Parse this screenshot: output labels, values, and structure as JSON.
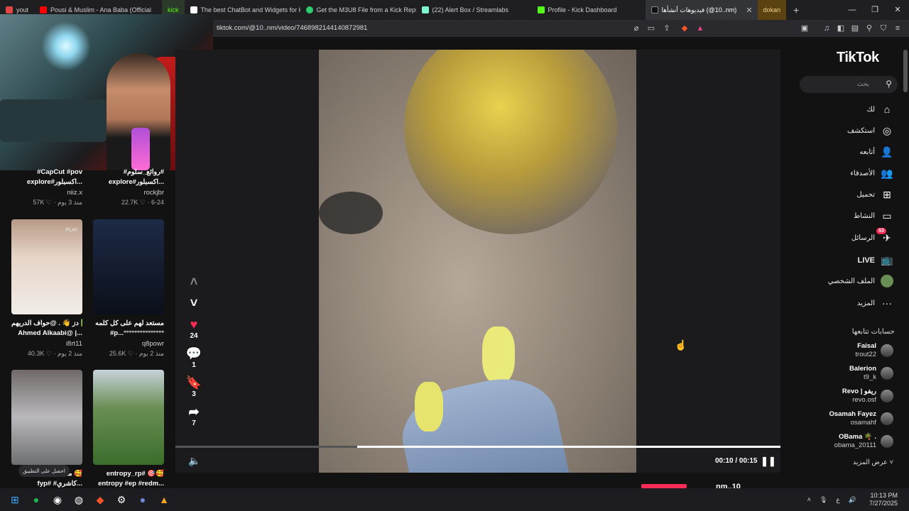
{
  "browser": {
    "tabs": [
      {
        "label": "yout",
        "color": "#e04646"
      },
      {
        "label": "Pousi & Muslim - Ana Baba (Official",
        "color": "#ff0000"
      },
      {
        "label": "kick",
        "color": "#53fc18"
      },
      {
        "label": "The best ChatBot and Widgets for Ki",
        "color": "#ffffff"
      },
      {
        "label": "Get the M3U8 File from a Kick Replay",
        "color": "#2ecc71"
      },
      {
        "label": "(22) Alert Box / Streamlabs",
        "color": "#80f5d2"
      },
      {
        "label": "Profile - Kick Dashboard",
        "color": "#53fc18"
      },
      {
        "label": "فيديوهات أنشأها (@10..nm)",
        "color": "#111111"
      },
      {
        "label": "dokan",
        "color": "#c99a2e"
      }
    ],
    "url": "tiktok.com/@10..nm/video/7468982144140872981"
  },
  "left_grid": {
    "cards": [
      {
        "caption": "#CapCut #pov",
        "caption2": "explore#اكسبلور...",
        "user": "niiz.x",
        "stat": "57K ♡ · منذ 3 يوم"
      },
      {
        "caption": "#روائع_سلوم#",
        "caption2": "explore#اكسبلور...",
        "user": "rockjbr",
        "stat": "22.7K ♡ · 6-24"
      },
      {
        "caption": "دز 👋 . @حواف الدريهم ✅",
        "caption2": "Ahmed Alkaabi@ |...",
        "user": "i8rt11",
        "stat": "40.3K ♡ · منذ 2 يوم"
      },
      {
        "caption": "مستعد لهم على كل كلمه",
        "caption2": "#p...°°°°°°°°°°°°°°°",
        "user": "q8powr",
        "stat": "25.6K ♡ · منذ 2 يوم"
      },
      {
        "caption": "ماشاء الله 🥰",
        "caption2": "fyp# #كاشري...",
        "user": "",
        "stat": ""
      },
      {
        "caption": "entropy_rp# 🎯🥰",
        "caption2": "entropy #ep #redm...",
        "user": "",
        "stat": ""
      }
    ],
    "note": "احصل على التطبيق",
    "play_badge": "PLAY"
  },
  "video": {
    "current_time": "00:10 / 00:15",
    "progress": 0.3,
    "likes": "24",
    "comments": "1",
    "saves": "3",
    "shares": "7",
    "bottom_user": "nm..10"
  },
  "sidebar": {
    "logo": "TikTok",
    "search_placeholder": "بحث",
    "items": [
      {
        "label": "لك",
        "icon": "home-icon"
      },
      {
        "label": "استكشف",
        "icon": "compass-icon"
      },
      {
        "label": "أتابعه",
        "icon": "following-icon"
      },
      {
        "label": "الأصدقاء",
        "icon": "friends-icon"
      },
      {
        "label": "تحميل",
        "icon": "upload-icon"
      },
      {
        "label": "النشاط",
        "icon": "activity-icon"
      },
      {
        "label": "الرسائل",
        "icon": "messages-icon",
        "badge": "53"
      },
      {
        "label": "LIVE",
        "icon": "live-icon"
      },
      {
        "label": "الملف الشخصي",
        "icon": "profile-icon"
      },
      {
        "label": "المزيد",
        "icon": "more-icon"
      }
    ],
    "following_title": "حسابات تتابعها",
    "following": [
      {
        "name": "Faisal",
        "handle": "trout22"
      },
      {
        "name": "Balerion",
        "handle": "t9_k"
      },
      {
        "name": "Revo | ريفو",
        "handle": "revo.osf"
      },
      {
        "name": "Osamah Fayez",
        "handle": "osamahf"
      },
      {
        "name": "OBama 🌴 .",
        "handle": "obama_20111"
      }
    ],
    "see_more": "عرض المزيد"
  },
  "taskbar": {
    "time": "10:13 PM",
    "date": "7/27/2025",
    "lang": "ع"
  }
}
